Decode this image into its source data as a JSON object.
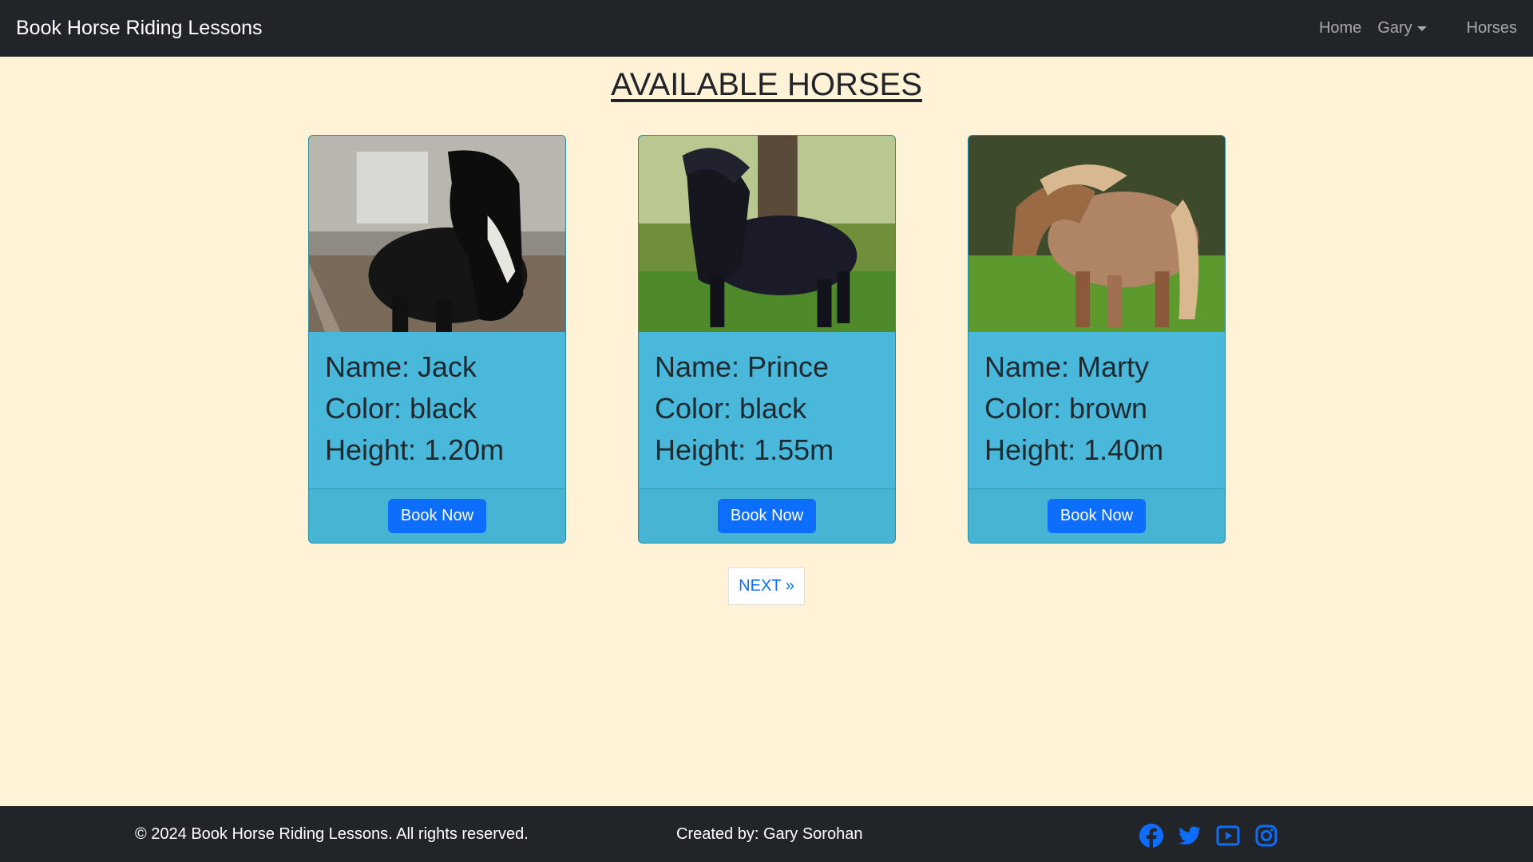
{
  "navbar": {
    "brand": "Book Horse Riding Lessons",
    "links": {
      "home": "Home",
      "user": "Gary",
      "horses": "Horses"
    }
  },
  "page_title": "AVAILABLE HORSES",
  "horses": [
    {
      "name_line": "Name: Jack",
      "color_line": "Color: black",
      "height_line": "Height: 1.20m",
      "button": "Book Now"
    },
    {
      "name_line": "Name: Prince",
      "color_line": "Color: black",
      "height_line": "Height: 1.55m",
      "button": "Book Now"
    },
    {
      "name_line": "Name: Marty",
      "color_line": "Color: brown",
      "height_line": "Height: 1.40m",
      "button": "Book Now"
    }
  ],
  "pagination": {
    "next": "NEXT »"
  },
  "footer": {
    "copyright": "© 2024 Book Horse Riding Lessons. All rights reserved.",
    "creator": "Created by: Gary Sorohan",
    "social_icons": [
      "facebook-icon",
      "twitter-icon",
      "youtube-icon",
      "instagram-icon"
    ]
  },
  "colors": {
    "page_bg": "#fff2d7",
    "navbar_bg": "#212529",
    "card_bg": "#4ab8da",
    "primary": "#0d6efd"
  }
}
